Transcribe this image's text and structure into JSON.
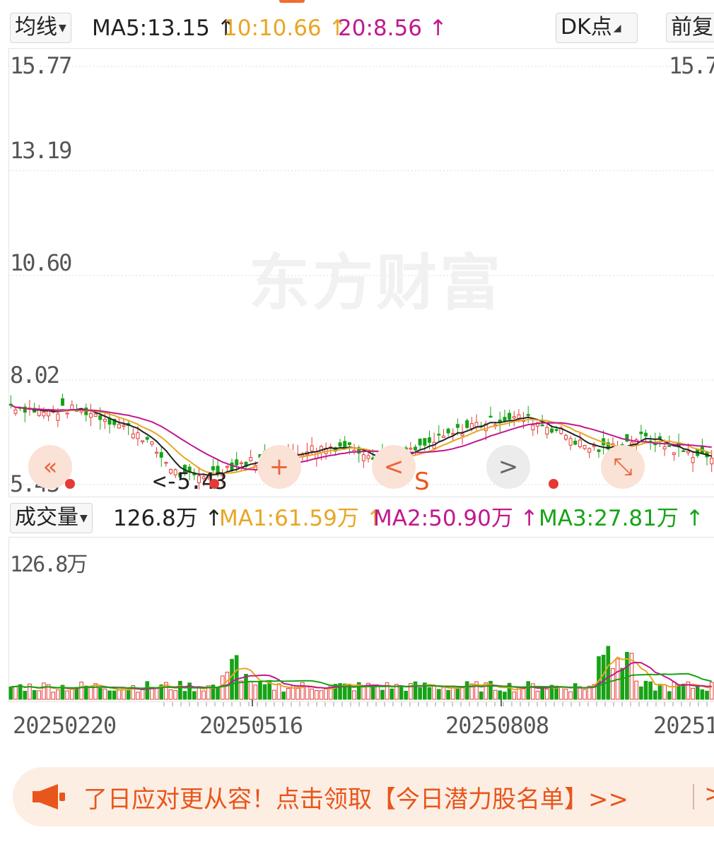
{
  "price_bar": {
    "dropdown": "均线",
    "ma5": "MA5:13.15 ↑",
    "ma10": "10:10.66 ↑",
    "ma20": "20:8.56 ↑",
    "dk_button": "DK点",
    "adjust_button": "前复"
  },
  "price_axis": {
    "labels": [
      "15.77",
      "13.19",
      "10.60",
      "8.02",
      "5.43"
    ],
    "right_label": "15.77",
    "low_marker": "<-5.43",
    "signal_label": "S"
  },
  "watermark": "东方财富",
  "volume_bar": {
    "dropdown": "成交量",
    "current": "126.8万 ↑",
    "ma1": "MA1:61.59万 ↑",
    "ma2": "MA2:50.90万 ↑",
    "ma3": "MA3:27.81万 ↑",
    "max_label": "126.8万"
  },
  "x_axis": {
    "labels": [
      "20250220",
      "20250516",
      "20250808",
      "20251"
    ]
  },
  "banner": {
    "text": "了日应对更从容！点击领取【今日潜力股名单】>>",
    "arrow": ">"
  },
  "colors": {
    "ma5": "#222222",
    "ma10": "#e8a624",
    "ma20": "#c0188e",
    "up": "#e53935",
    "down": "#16a316",
    "vol_ma3": "#16a316",
    "accent": "#e8561b"
  },
  "chart_data": {
    "type": "candlestick",
    "ylim": [
      5.43,
      15.77
    ],
    "y_ticks": [
      15.77,
      13.19,
      10.6,
      8.02,
      5.43
    ],
    "x_tick_labels": [
      "20250220",
      "20250516",
      "20250808",
      "20251"
    ],
    "ma_values": {
      "MA5": 13.15,
      "MA10": 10.66,
      "MA20": 8.56
    },
    "low_value": 5.43,
    "close_trend": [
      7.4,
      7.3,
      7.2,
      7.3,
      7.25,
      7.1,
      6.9,
      6.7,
      6.2,
      5.7,
      5.6,
      5.75,
      5.9,
      6.0,
      6.1,
      6.15,
      6.3,
      6.35,
      6.4,
      6.3,
      6.1,
      6.1,
      6.3,
      6.5,
      6.7,
      6.9,
      7.0,
      7.1,
      7.05,
      6.9,
      6.7,
      6.4,
      6.3,
      6.4,
      6.6,
      6.5,
      6.3,
      6.2,
      6.1
    ],
    "volume": {
      "max": "126.8万",
      "MA1": "61.59万",
      "MA2": "50.90万",
      "MA3": "27.81万"
    }
  }
}
